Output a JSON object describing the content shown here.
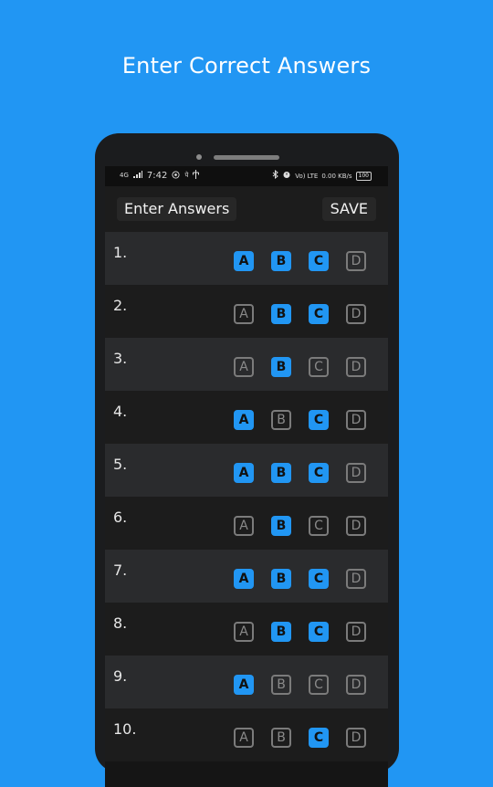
{
  "headline": "Enter Correct Answers",
  "status_bar": {
    "network": "4G",
    "time": "7:42",
    "whatsapp_icon": "whatsapp-icon",
    "app_glyph": "पे",
    "usb_icon": "usb-icon",
    "lte_label": "Vo) LTE",
    "data_speed": "0.00 KB/s",
    "battery": "100"
  },
  "app_bar": {
    "title": "Enter Answers",
    "save_label": "SAVE"
  },
  "colors": {
    "background": "#2196F3",
    "selected": "#2196F3",
    "unselected_border": "#7b7b7b"
  },
  "questions": [
    {
      "label": "1.",
      "options": [
        {
          "letter": "A",
          "selected": true
        },
        {
          "letter": "B",
          "selected": true
        },
        {
          "letter": "C",
          "selected": true
        },
        {
          "letter": "D",
          "selected": false
        }
      ]
    },
    {
      "label": "2.",
      "options": [
        {
          "letter": "A",
          "selected": false
        },
        {
          "letter": "B",
          "selected": true
        },
        {
          "letter": "C",
          "selected": true
        },
        {
          "letter": "D",
          "selected": false
        }
      ]
    },
    {
      "label": "3.",
      "options": [
        {
          "letter": "A",
          "selected": false
        },
        {
          "letter": "B",
          "selected": true
        },
        {
          "letter": "C",
          "selected": false
        },
        {
          "letter": "D",
          "selected": false
        }
      ]
    },
    {
      "label": "4.",
      "options": [
        {
          "letter": "A",
          "selected": true
        },
        {
          "letter": "B",
          "selected": false
        },
        {
          "letter": "C",
          "selected": true
        },
        {
          "letter": "D",
          "selected": false
        }
      ]
    },
    {
      "label": "5.",
      "options": [
        {
          "letter": "A",
          "selected": true
        },
        {
          "letter": "B",
          "selected": true
        },
        {
          "letter": "C",
          "selected": true
        },
        {
          "letter": "D",
          "selected": false
        }
      ]
    },
    {
      "label": "6.",
      "options": [
        {
          "letter": "A",
          "selected": false
        },
        {
          "letter": "B",
          "selected": true
        },
        {
          "letter": "C",
          "selected": false
        },
        {
          "letter": "D",
          "selected": false
        }
      ]
    },
    {
      "label": "7.",
      "options": [
        {
          "letter": "A",
          "selected": true
        },
        {
          "letter": "B",
          "selected": true
        },
        {
          "letter": "C",
          "selected": true
        },
        {
          "letter": "D",
          "selected": false
        }
      ]
    },
    {
      "label": "8.",
      "options": [
        {
          "letter": "A",
          "selected": false
        },
        {
          "letter": "B",
          "selected": true
        },
        {
          "letter": "C",
          "selected": true
        },
        {
          "letter": "D",
          "selected": false
        }
      ]
    },
    {
      "label": "9.",
      "options": [
        {
          "letter": "A",
          "selected": true
        },
        {
          "letter": "B",
          "selected": false
        },
        {
          "letter": "C",
          "selected": false
        },
        {
          "letter": "D",
          "selected": false
        }
      ]
    },
    {
      "label": "10.",
      "options": [
        {
          "letter": "A",
          "selected": false
        },
        {
          "letter": "B",
          "selected": false
        },
        {
          "letter": "C",
          "selected": true
        },
        {
          "letter": "D",
          "selected": false
        }
      ]
    }
  ]
}
